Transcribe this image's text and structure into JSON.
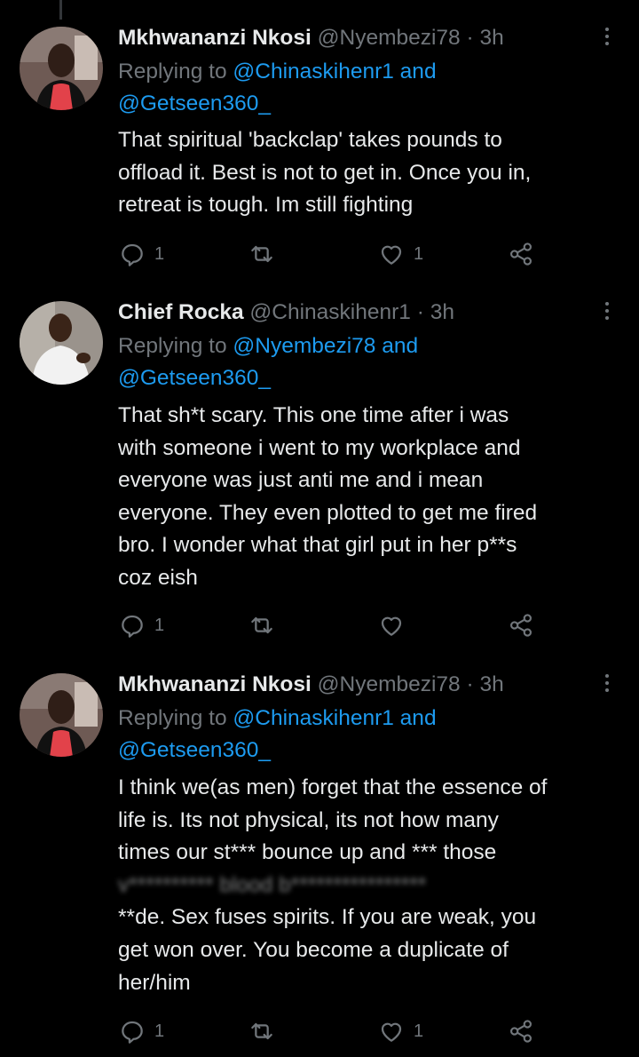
{
  "tweets": [
    {
      "name": "Mkhwananzi Nkosi",
      "handle": "@Nyembezi78",
      "separator": "·",
      "time": "3h",
      "replying_prefix": "Replying to",
      "replying_users": "@Chinaskihenr1 and",
      "replying_users_2": "@Getseen360_",
      "body_lines": [
        "That spiritual 'backclap' takes pounds to",
        "offload it. Best is not to get in. Once you in,",
        "retreat is tough. Im still fighting"
      ],
      "reply_count": "1",
      "retweet_count": "",
      "like_count": "1",
      "icons": [
        "more-icon",
        "reply-icon",
        "retweet-icon",
        "like-icon",
        "share-icon"
      ]
    },
    {
      "name": "Chief Rocka",
      "handle": "@Chinaskihenr1",
      "separator": "·",
      "time": "3h",
      "replying_prefix": "Replying to",
      "replying_users": "@Nyembezi78 and",
      "replying_users_2": "@Getseen360_",
      "body_lines": [
        "That sh*t scary. This one time after i was",
        "with someone i went to my workplace and",
        "everyone was just anti me and i mean",
        "everyone. They even plotted to get me fired",
        "bro. I wonder what that girl put in her p**s",
        "coz eish"
      ],
      "reply_count": "1",
      "retweet_count": "",
      "like_count": "",
      "icons": [
        "more-icon",
        "reply-icon",
        "retweet-icon",
        "like-icon",
        "share-icon"
      ]
    },
    {
      "name": "Mkhwananzi Nkosi",
      "handle": "@Nyembezi78",
      "separator": "·",
      "time": "3h",
      "replying_prefix": "Replying to",
      "replying_users": "@Chinaskihenr1 and",
      "replying_users_2": "@Getseen360_",
      "body_lines": [
        "I think we(as men) forget that the essence of",
        "life is. Its not physical, its not how many",
        "times our st*** bounce up and *** those",
        "v********** blood b****************",
        "**de. Sex fuses spirits. If you are weak, you",
        "get won over. You become a duplicate of",
        "her/him"
      ],
      "reply_count": "1",
      "retweet_count": "",
      "like_count": "1",
      "icons": [
        "more-icon",
        "reply-icon",
        "retweet-icon",
        "like-icon",
        "share-icon"
      ]
    }
  ],
  "colors": {
    "background": "#000000",
    "primary_text": "#e7e9ea",
    "secondary_text": "#71767b",
    "link": "#1d9bf0"
  }
}
